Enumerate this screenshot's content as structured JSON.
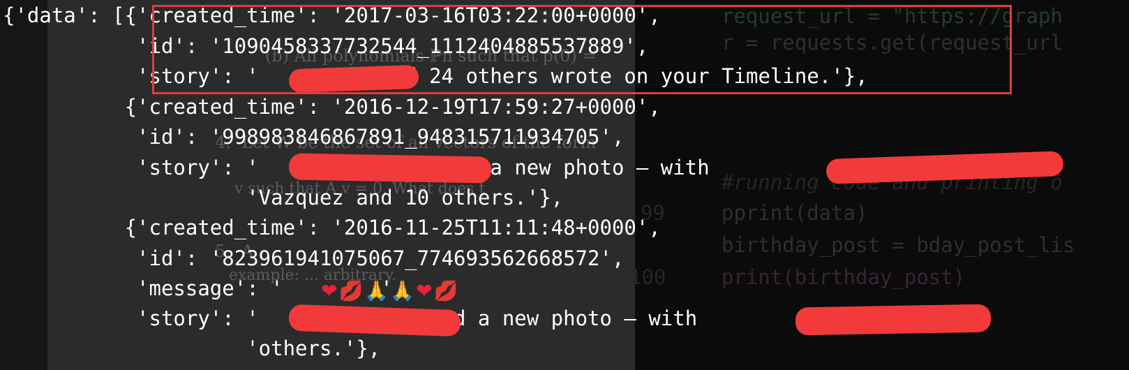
{
  "terminal": {
    "lines": [
      "{'data': [{'created_time': '2017-03-16T03:22:00+0000',",
      "           'id': '1090458337732544_1112404885537889',",
      "           'story': '          and 24 others wrote on your Timeline.'},",
      "          {'created_time': '2016-12-19T17:59:27+0000',",
      "           'id': '998983846867891_948315711934705',",
      "           'story': '             added a new photo — with              '",
      "                    'Vazquez and 10 others.'},",
      "          {'created_time': '2016-11-25T11:11:48+0000',",
      "           'id': '823961941075067_774693562668572',",
      "           'message': '        ',",
      "           'story': '            added a new photo — with             and 8 '",
      "                    'others.'},"
    ],
    "emoji": [
      "❤",
      "💋",
      "🙏",
      "🙏",
      "❤",
      "💋"
    ]
  },
  "background": {
    "doc_fragments": [
      "(b) All polynomials ℙn such that p(0) =",
      "4.  Let W be the set of all vectors of the form",
      "v such that A v = 0. What does t",
      "5.  A",
      "example: ... arbitrary."
    ],
    "code_lines": [
      {
        "num": "",
        "text": "request_url = \"https://graph"
      },
      {
        "num": "",
        "text": "r = requests.get(request_url"
      },
      {
        "num": "",
        "text": "#running code and printing o"
      },
      {
        "num": "99",
        "text": "pprint(data)"
      },
      {
        "num": "",
        "text": "birthday_post = bday_post_lis"
      },
      {
        "num": "100",
        "text": "print(birthday_post)"
      }
    ]
  },
  "colors": {
    "highlight_box": "#e23c3c",
    "redaction": "#f23a3a",
    "text": "#ffffff"
  }
}
